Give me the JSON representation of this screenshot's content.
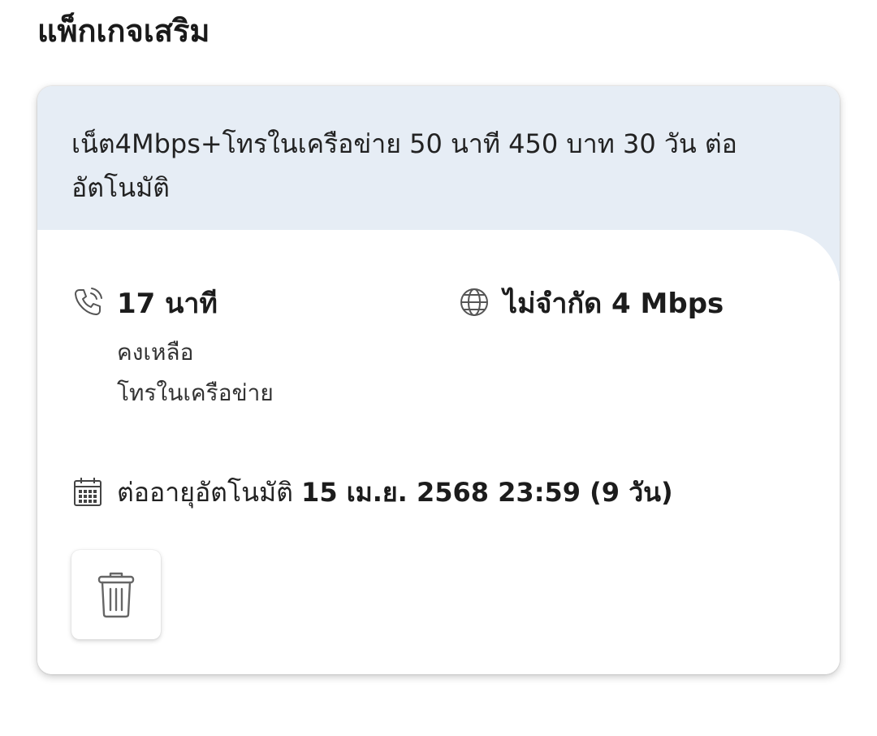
{
  "section": {
    "title": "แพ็กเกจเสริม"
  },
  "package": {
    "name": "เน็ต4Mbps+โทรในเครือข่าย 50 นาที 450 บาท 30 วัน ต่ออัตโนมัติ",
    "voice": {
      "icon": "phone-icon",
      "value": "17 นาที",
      "remaining_label": "คงเหลือ",
      "type_label": "โทรในเครือข่าย"
    },
    "data": {
      "icon": "globe-icon",
      "value": "ไม่จำกัด 4 Mbps"
    },
    "renewal": {
      "icon": "calendar-icon",
      "label": "ต่ออายุอัตโนมัติ",
      "date": "15 เม.ย. 2568 23:59 (9 วัน)"
    },
    "delete": {
      "icon": "trash-icon"
    }
  }
}
